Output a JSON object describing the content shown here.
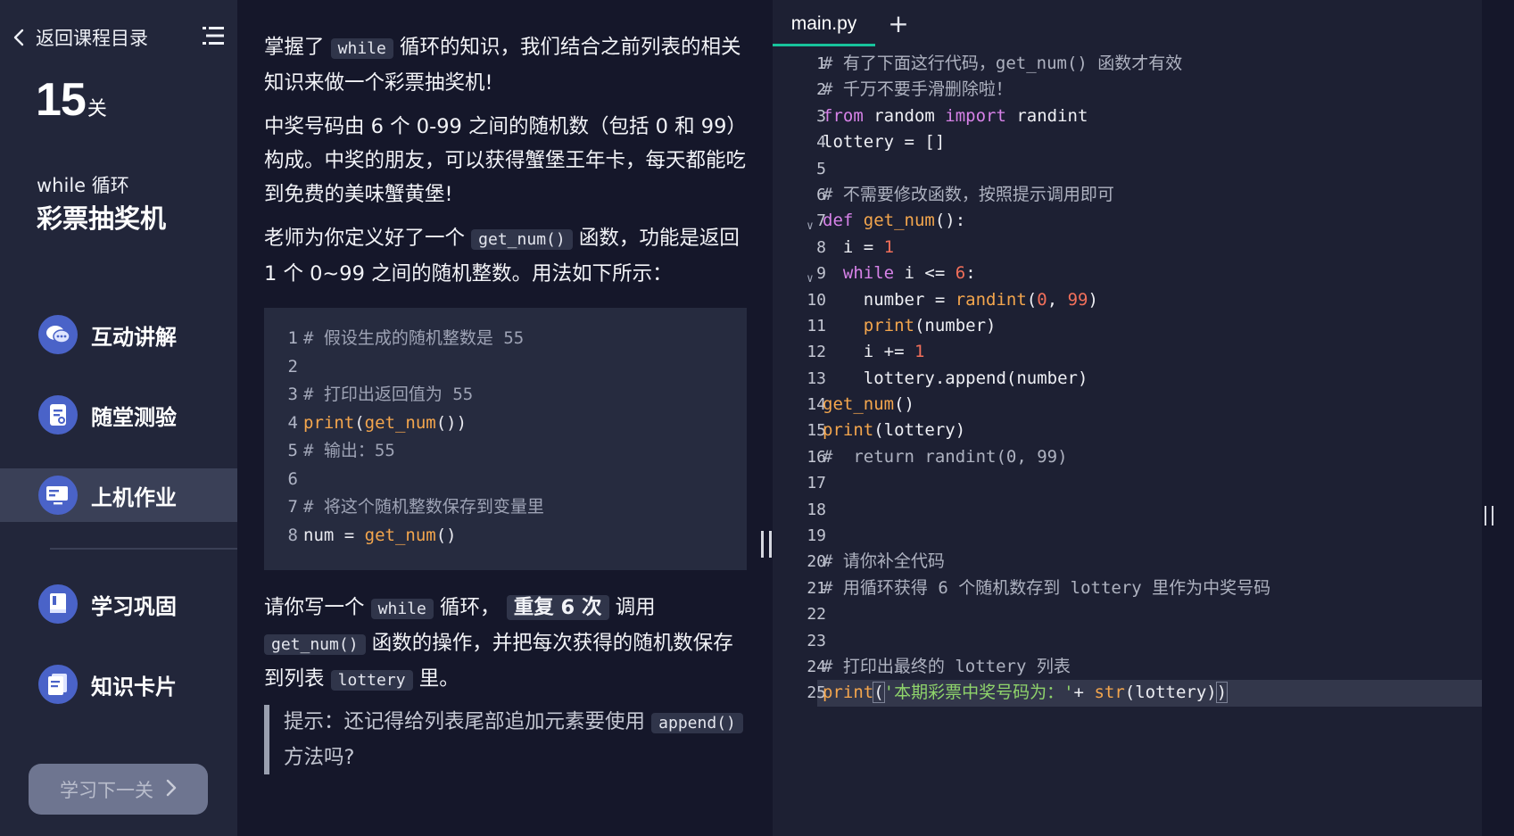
{
  "sidebar": {
    "back_label": "返回课程目录",
    "level_number": "15",
    "level_unit": "关",
    "topic": "while 循环",
    "title": "彩票抽奖机",
    "nav": [
      {
        "label": "互动讲解",
        "icon": "chat-icon",
        "active": false
      },
      {
        "label": "随堂测验",
        "icon": "quiz-icon",
        "active": false
      },
      {
        "label": "上机作业",
        "icon": "computer-icon",
        "active": true
      },
      {
        "label": "学习巩固",
        "icon": "book-icon",
        "active": false
      },
      {
        "label": "知识卡片",
        "icon": "card-icon",
        "active": false
      }
    ],
    "next_button": "学习下一关"
  },
  "instructions": {
    "p1": {
      "a": "掌握了",
      "code": "while",
      "b": "循环的知识，我们结合之前列表的相关知识来做一个彩票抽奖机!"
    },
    "p2": "中奖号码由 6 个 0-99 之间的随机数（包括 0 和 99）构成。中奖的朋友，可以获得蟹堡王年卡，每天都能吃到免费的美味蟹黄堡!",
    "p3": {
      "a": "老师为你定义好了一个",
      "code": "get_num()",
      "b": "函数，功能是返回 1 个 0~99 之间的随机整数。用法如下所示："
    },
    "example": [
      {
        "n": "1",
        "comment": "# 假设生成的随机整数是 55"
      },
      {
        "n": "2"
      },
      {
        "n": "3",
        "comment": "# 打印出返回值为 55"
      },
      {
        "n": "4",
        "fn1": "print",
        "p1": "(",
        "fn2": "get_num",
        "p2": "())"
      },
      {
        "n": "5",
        "comment": "# 输出：55"
      },
      {
        "n": "6"
      },
      {
        "n": "7",
        "comment": "# 将这个随机整数保存到变量里"
      },
      {
        "n": "8",
        "pre": "num = ",
        "fn2": "get_num",
        "p2": "()"
      }
    ],
    "p4": {
      "a": "请你写一个",
      "code1": "while",
      "b": "循环，",
      "bold": "重复 6 次",
      "c": "调用",
      "code2": "get_num()",
      "d": "函数的操作，并把每次获得的随机数保存到列表",
      "code3": "lottery",
      "e": "里。"
    },
    "hint": {
      "a": "提示：还记得给列表尾部追加元素要使用",
      "code": "append()",
      "b": "方法吗?"
    }
  },
  "editor": {
    "tab_label": "main.py",
    "add_tab": "+",
    "lines": [
      {
        "n": "1",
        "tokens": [
          [
            "cm",
            "# 有了下面这行代码，get_num() 函数才有效"
          ]
        ]
      },
      {
        "n": "2",
        "tokens": [
          [
            "cm",
            "# 千万不要手滑删除啦！"
          ]
        ]
      },
      {
        "n": "3",
        "tokens": [
          [
            "kw",
            "from"
          ],
          [
            "plain",
            " random "
          ],
          [
            "kw",
            "import"
          ],
          [
            "plain",
            " randint"
          ]
        ]
      },
      {
        "n": "4",
        "tokens": [
          [
            "plain",
            "lottery = []"
          ]
        ]
      },
      {
        "n": "5",
        "tokens": []
      },
      {
        "n": "6",
        "tokens": [
          [
            "cm",
            "# 不需要修改函数，按照提示调用即可"
          ]
        ]
      },
      {
        "n": "7",
        "fold": true,
        "tokens": [
          [
            "kw",
            "def"
          ],
          [
            "plain",
            " "
          ],
          [
            "fn",
            "get_num"
          ],
          [
            "plain",
            "():"
          ]
        ]
      },
      {
        "n": "8",
        "tokens": [
          [
            "plain",
            "  i = "
          ],
          [
            "num",
            "1"
          ]
        ]
      },
      {
        "n": "9",
        "fold": true,
        "tokens": [
          [
            "plain",
            "  "
          ],
          [
            "kw",
            "while"
          ],
          [
            "plain",
            " i <= "
          ],
          [
            "num",
            "6"
          ],
          [
            "plain",
            ":"
          ]
        ]
      },
      {
        "n": "10",
        "tokens": [
          [
            "plain",
            "    number = "
          ],
          [
            "fn",
            "randint"
          ],
          [
            "plain",
            "("
          ],
          [
            "num",
            "0"
          ],
          [
            "plain",
            ", "
          ],
          [
            "num",
            "99"
          ],
          [
            "plain",
            ")"
          ]
        ]
      },
      {
        "n": "11",
        "tokens": [
          [
            "plain",
            "    "
          ],
          [
            "fn",
            "print"
          ],
          [
            "plain",
            "(number)"
          ]
        ]
      },
      {
        "n": "12",
        "tokens": [
          [
            "plain",
            "    i += "
          ],
          [
            "num",
            "1"
          ]
        ]
      },
      {
        "n": "13",
        "tokens": [
          [
            "plain",
            "    lottery.append(number)"
          ]
        ]
      },
      {
        "n": "14",
        "tokens": [
          [
            "fn",
            "get_num"
          ],
          [
            "plain",
            "()"
          ]
        ]
      },
      {
        "n": "15",
        "tokens": [
          [
            "fn",
            "print"
          ],
          [
            "plain",
            "(lottery)"
          ]
        ]
      },
      {
        "n": "16",
        "tokens": [
          [
            "cm",
            "#  return randint(0, 99)"
          ]
        ]
      },
      {
        "n": "17",
        "tokens": []
      },
      {
        "n": "18",
        "tokens": []
      },
      {
        "n": "19",
        "tokens": []
      },
      {
        "n": "20",
        "tokens": [
          [
            "cm",
            "# 请你补全代码"
          ]
        ]
      },
      {
        "n": "21",
        "tokens": [
          [
            "cm",
            "# 用循环获得 6 个随机数存到 lottery 里作为中奖号码"
          ]
        ]
      },
      {
        "n": "22",
        "tokens": []
      },
      {
        "n": "23",
        "tokens": []
      },
      {
        "n": "24",
        "tokens": [
          [
            "cm",
            "# 打印出最终的 lottery 列表"
          ]
        ]
      },
      {
        "n": "25",
        "current": true,
        "tokens": [
          [
            "fn",
            "print"
          ],
          [
            "br",
            "("
          ],
          [
            "str",
            "'本期彩票中奖号码为：'"
          ],
          [
            "plain",
            "+ "
          ],
          [
            "fn",
            "str"
          ],
          [
            "plain",
            "(lottery)"
          ],
          [
            "br",
            ")"
          ]
        ]
      }
    ]
  },
  "colors": {
    "accent_tab": "#17c39c",
    "nav_icon_bg": "#4a63c8",
    "keyword": "#d782e8",
    "function": "#f4a64d",
    "number": "#f26f5a",
    "string": "#8fd46b"
  }
}
